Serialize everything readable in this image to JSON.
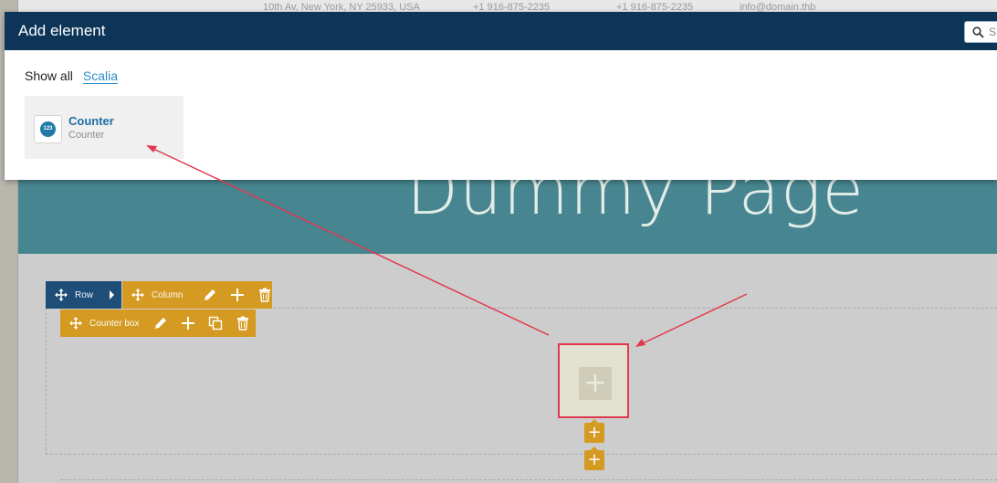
{
  "topbar": {
    "address": "10th Av, New York, NY 25933, USA",
    "phone": "+1 916-875-2235",
    "fax": "+1 916-875-2235",
    "email": "info@domain.thb"
  },
  "page": {
    "title": "Dummy Page"
  },
  "toolbars": {
    "row_label": "Row",
    "column_label": "Column",
    "counter_box_label": "Counter box"
  },
  "modal": {
    "title": "Add element",
    "search_placeholder": "S",
    "tabs": [
      "Show all",
      "Scalia"
    ],
    "elements": [
      {
        "name": "Counter",
        "description": "Counter",
        "icon_text": "123",
        "icon": "counter-icon"
      }
    ]
  },
  "colors": {
    "modal_header": "#0c3558",
    "hero": "#478690",
    "row_toolbar": "#1e4d78",
    "element_toolbar": "#d59a22",
    "annotation": "#e0394d"
  }
}
